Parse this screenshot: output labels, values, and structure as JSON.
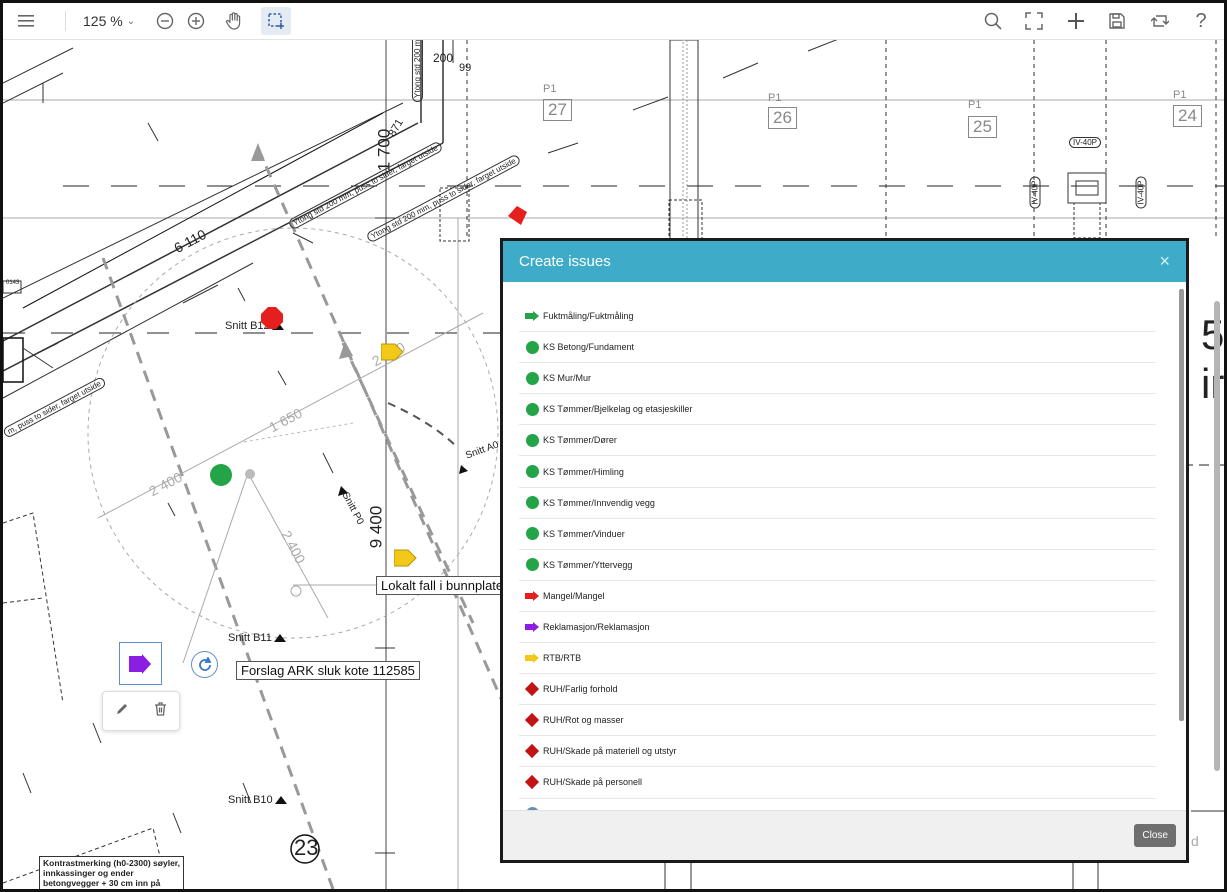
{
  "toolbar": {
    "zoom_value": "125 %",
    "icons": [
      "menu-icon",
      "zoom-out-icon",
      "zoom-in-icon",
      "hand-pan-icon",
      "select-area-icon",
      "search-icon",
      "fullscreen-icon",
      "add-icon",
      "save-icon",
      "swap-icon",
      "help-icon"
    ]
  },
  "drawing": {
    "sheet_numbers": [
      {
        "prefix": "P1",
        "number": "27"
      },
      {
        "prefix": "P1",
        "number": "26"
      },
      {
        "prefix": "P1",
        "number": "25"
      },
      {
        "prefix": "P1",
        "number": "24"
      }
    ],
    "dimensions": [
      "200",
      "99",
      "871",
      "1 700",
      "6 110",
      "1 650",
      "2 400",
      "2 400",
      "9 400",
      "2 400"
    ],
    "column_tags": [
      "IV-40P",
      "IV-40P",
      "IV-40P"
    ],
    "wall_notes": [
      "Ytong std 200 mm",
      "Ytong std 200 mm, puss to sider, farget utside",
      "Ytong std 200 mm, puss to sider, farget utside",
      "m, puss to sider, farget utside"
    ],
    "sections": [
      "Snitt B12",
      "Snitt B11",
      "Snitt B10",
      "Snitt A0",
      "Snitt P0"
    ],
    "notes": [
      "Lokalt fall i bunnplate",
      "Forslag ARK sluk kote 112585"
    ],
    "grid_number": "23",
    "left_tag": "0143",
    "corner_note": "Kontrastmerking (h0-2300) søyler, innkassinger og ender betongvegger + 30 cm inn på",
    "right_partial": [
      "5",
      "ir"
    ],
    "footer_partial": "d"
  },
  "modal": {
    "title": "Create issues",
    "close_x": "×",
    "close_label": "Close",
    "items": [
      {
        "label": "Fuktmåling/Fuktmåling",
        "icon": "arrow",
        "color": "#22a447"
      },
      {
        "label": "KS Betong/Fundament",
        "icon": "circle",
        "color": "#22a447"
      },
      {
        "label": "KS Mur/Mur",
        "icon": "circle",
        "color": "#22a447"
      },
      {
        "label": "KS Tømmer/Bjelkelag og etasjeskiller",
        "icon": "circle",
        "color": "#22a447"
      },
      {
        "label": "KS Tømmer/Dører",
        "icon": "circle",
        "color": "#22a447"
      },
      {
        "label": "KS Tømmer/Himling",
        "icon": "circle",
        "color": "#22a447"
      },
      {
        "label": "KS Tømmer/Innvendig vegg",
        "icon": "circle",
        "color": "#22a447"
      },
      {
        "label": "KS Tømmer/Vinduer",
        "icon": "circle",
        "color": "#22a447"
      },
      {
        "label": "KS Tømmer/Yttervegg",
        "icon": "circle",
        "color": "#22a447"
      },
      {
        "label": "Mangel/Mangel",
        "icon": "arrow",
        "color": "#e51e1e"
      },
      {
        "label": "Reklamasjon/Reklamasjon",
        "icon": "arrow",
        "color": "#8b1ee0"
      },
      {
        "label": "RTB/RTB",
        "icon": "arrow",
        "color": "#f2c919"
      },
      {
        "label": "RUH/Farlig forhold",
        "icon": "diamond",
        "color": "#c41313"
      },
      {
        "label": "RUH/Rot og masser",
        "icon": "diamond",
        "color": "#c41313"
      },
      {
        "label": "RUH/Skade på materiell og utstyr",
        "icon": "diamond",
        "color": "#c41313"
      },
      {
        "label": "RUH/Skade på personell",
        "icon": "diamond",
        "color": "#c41313"
      },
      {
        "label": "",
        "icon": "circle",
        "color": "#6a8fb5"
      }
    ]
  }
}
